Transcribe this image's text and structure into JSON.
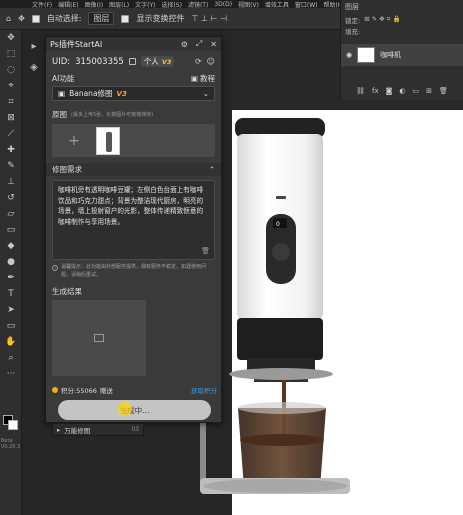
{
  "menubar": [
    "文件(F)",
    "编辑(E)",
    "图像(I)",
    "图层(L)",
    "文字(Y)",
    "选择(S)",
    "滤镜(T)",
    "3D(D)",
    "视图(V)",
    "增效工具",
    "窗口(W)",
    "帮助(H)"
  ],
  "options_bar": {
    "auto_select_label": "自动选择:",
    "auto_select_value": "图层",
    "show_transform_label": "显示变换控件"
  },
  "layers_panel": {
    "tab": "图层",
    "lock_label": "锁定:",
    "fill_label": "填充:",
    "layer_name": "咖啡机",
    "fx_label": "fx"
  },
  "plugin": {
    "title": "Ps插件StartAI",
    "uid_label": "UID:",
    "uid_value": "315003355",
    "account_type": "个人",
    "account_version": "V3",
    "ai_function_label": "AI功能",
    "help_link": "教程",
    "model_name": "Banana修图",
    "model_version": "V3",
    "original_label": "原图",
    "original_hint": "(最多上传5张，长按图片可拖拽排序)",
    "prompt_label": "修图需求",
    "prompt_text": "咖啡机旁有透明咖啡豆罐；左侧白色台面上有咖啡饮品和巧克力甜点；背景为整洁现代厨房，明亮的场景，墙上投射窗户的光影，整体传递精致惬意的咖啡制作与享用场景。",
    "warning_text": "温馨提示：此功能由外部服务提供，偶有服务不稳定，如遇使用问题，请稍后重试。",
    "result_label": "生成结果",
    "credits_label": "积分:55066",
    "credits_extra": "赠送",
    "get_credits_link": "获取积分",
    "generate_button": "生成中..."
  },
  "beta_label": "Beta\nV0.20.3",
  "under_tab": {
    "label": "万能修图",
    "count": "03"
  }
}
